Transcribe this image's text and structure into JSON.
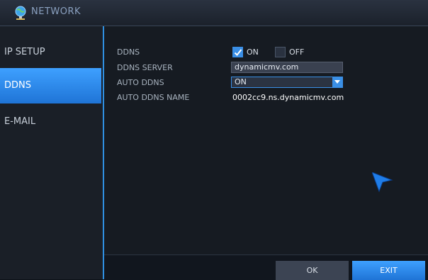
{
  "window": {
    "title": "NETWORK"
  },
  "sidebar": {
    "items": [
      {
        "label": "IP SETUP",
        "active": false
      },
      {
        "label": "DDNS",
        "active": true
      },
      {
        "label": "E-MAIL",
        "active": false
      }
    ]
  },
  "ddns": {
    "label": "DDNS",
    "on_label": "ON",
    "off_label": "OFF",
    "on_checked": true,
    "off_checked": false
  },
  "ddns_server": {
    "label": "DDNS SERVER",
    "value": "dynamicmv.com"
  },
  "auto_ddns": {
    "label": "AUTO DDNS",
    "value": "ON"
  },
  "auto_ddns_name": {
    "label": "AUTO DDNS NAME",
    "value": "0002cc9.ns.dynamicmv.com"
  },
  "footer": {
    "ok_label": "OK",
    "exit_label": "EXIT"
  },
  "colors": {
    "accent": "#3a8fe6",
    "active_tab": "#2f8fe0"
  }
}
